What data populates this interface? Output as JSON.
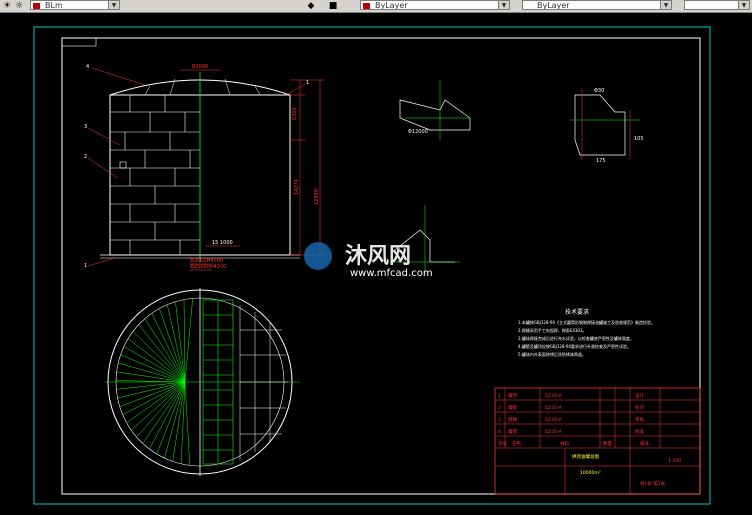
{
  "toolbar": {
    "layer_left": "BLm",
    "layer_mid": "ByLayer",
    "layer_right": "ByLayer"
  },
  "dimensions": {
    "top_width": "R2000",
    "top_right": "6300",
    "height_total": "12800",
    "height_inner": "14274",
    "inner_dia": "15 1000",
    "bottom_1": "Φ3000H4500",
    "bottom_2": "Φ25000H4200",
    "detail_a": "Φ12000",
    "detail_b_1": "Φ30",
    "detail_b_2": "175",
    "detail_b_3": "105"
  },
  "callouts": [
    "4",
    "1",
    "3",
    "2",
    "1"
  ],
  "notes": {
    "title": "技术要求",
    "lines": [
      "1.本罐按GBJ128-90《立式圆筒形钢制焊接油罐施工及验收规范》制造检验。",
      "2.焊缝采用手工电弧焊，焊条E4303。",
      "3.罐体焊接完成后进行充水试验，以检查罐底严密性及罐体强度。",
      "4.罐壁及罐顶应按GBJ128-90要求进行外观检查及严密性试验。",
      "5.罐体内外表面除锈后涂防锈漆两道。"
    ]
  },
  "title_block": {
    "rows_left": [
      [
        "1",
        "罐顶",
        "Q235-A",
        "1",
        "",
        "",
        ""
      ],
      [
        "2",
        "罐壁",
        "Q235-A",
        "1",
        "",
        "",
        ""
      ],
      [
        "3",
        "盘梯",
        "Q235-A",
        "1",
        "",
        "",
        ""
      ],
      [
        "4",
        "罐底",
        "Q235-A",
        "1",
        "",
        "",
        ""
      ]
    ],
    "header_labels": [
      "序号",
      "名称",
      "材料",
      "数量",
      "备注"
    ],
    "drawing_name": "拱顶油罐总图",
    "capacity": "10000m³",
    "right_cells": [
      "设计",
      "校对",
      "审核",
      "批准"
    ],
    "scale": "1:100",
    "sheet": "共1张 第1张"
  },
  "watermark": {
    "brand": "沐风网",
    "url": "www.mfcad.com"
  },
  "colors": {
    "background": "#000000",
    "frame_outer": "#00c8c8",
    "frame_inner": "#ffffff",
    "centerline": "#00ff00",
    "dimension": "#ff3030",
    "annotation": "#ffffff",
    "title_block": "#ff3030"
  }
}
